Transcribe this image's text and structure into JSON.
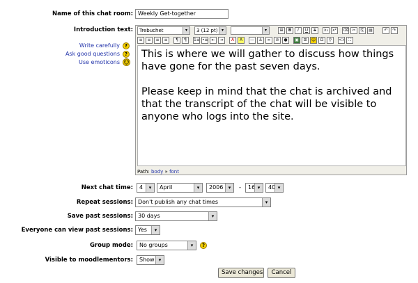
{
  "form": {
    "name": {
      "label": "Name of this chat room:",
      "value": "Weekly Get-together"
    },
    "intro": {
      "label": "Introduction text:"
    },
    "help_links": [
      {
        "label": "Write carefully",
        "icon": "question-icon"
      },
      {
        "label": "Ask good questions",
        "icon": "question-icon"
      },
      {
        "label": "Use emoticons",
        "icon": "smiley-icon"
      }
    ],
    "editor": {
      "font_family": "Trebuchet",
      "font_size": "3 (12 pt)",
      "paragraph_format": "",
      "paragraphs": [
        "This is where we will gather to discuss how things have gone for the past seven days.",
        "Please keep in mind that the chat is archived and that the transcript of the chat will be visible to anyone who logs into the site."
      ],
      "path_label": "Path:",
      "path_body": "body",
      "path_sep": "»",
      "path_font": "font"
    },
    "next_chat": {
      "label": "Next chat time:",
      "day": "4",
      "month": "April",
      "year": "2006",
      "hour": "16",
      "minute": "40",
      "separator": "-"
    },
    "repeat": {
      "label": "Repeat sessions:",
      "value": "Don't publish any chat times"
    },
    "save_past": {
      "label": "Save past sessions:",
      "value": "30 days"
    },
    "everyone_view": {
      "label": "Everyone can view past sessions:",
      "value": "Yes"
    },
    "group_mode": {
      "label": "Group mode:",
      "value": "No groups"
    },
    "visible": {
      "label": "Visible to moodlementors:",
      "value": "Show"
    },
    "buttons": {
      "save": "Save changes",
      "cancel": "Cancel"
    }
  },
  "icons": {
    "arrow": "▾"
  }
}
